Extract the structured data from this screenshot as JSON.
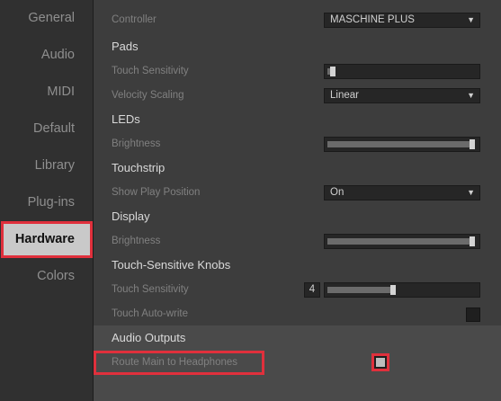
{
  "sidebar": {
    "items": [
      {
        "label": "General"
      },
      {
        "label": "Audio"
      },
      {
        "label": "MIDI"
      },
      {
        "label": "Default"
      },
      {
        "label": "Library"
      },
      {
        "label": "Plug-ins"
      },
      {
        "label": "Hardware",
        "active": true
      },
      {
        "label": "Colors"
      }
    ]
  },
  "hardware": {
    "controller": {
      "label": "Controller",
      "value": "MASCHINE PLUS"
    },
    "pads": {
      "title": "Pads",
      "touch_sensitivity": {
        "label": "Touch Sensitivity",
        "level": 0.02
      },
      "velocity_scaling": {
        "label": "Velocity Scaling",
        "value": "Linear"
      }
    },
    "leds": {
      "title": "LEDs",
      "brightness": {
        "label": "Brightness",
        "level": 1.0
      }
    },
    "touchstrip": {
      "title": "Touchstrip",
      "show_play_position": {
        "label": "Show Play Position",
        "value": "On"
      }
    },
    "display": {
      "title": "Display",
      "brightness": {
        "label": "Brightness",
        "level": 1.0
      }
    },
    "knobs": {
      "title": "Touch-Sensitive Knobs",
      "touch_sensitivity": {
        "label": "Touch Sensitivity",
        "value": "4",
        "level": 0.44
      },
      "touch_auto_write": {
        "label": "Touch Auto-write",
        "checked": false
      }
    },
    "audio_outputs": {
      "title": "Audio Outputs",
      "route_main": {
        "label": "Route Main to Headphones",
        "checked": true
      }
    }
  },
  "colors": {
    "highlight": "#e0303c",
    "active_tab_bg": "#c9c9c9"
  }
}
